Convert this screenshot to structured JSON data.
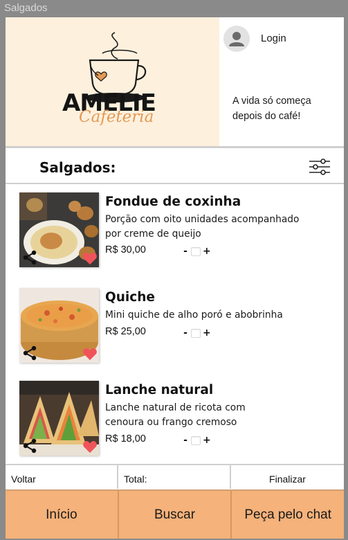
{
  "window": {
    "title": "Salgados"
  },
  "header": {
    "logo_title": "AMELIE",
    "logo_subtitle": "Cafeteria",
    "login_label": "Login",
    "tagline": "A vida só começa depois do café!"
  },
  "section": {
    "title": "Salgados:"
  },
  "items": [
    {
      "name": "Fondue de coxinha",
      "description": "Porção com oito unidades acompanhado por creme de queijo",
      "price": "R$ 30,00",
      "minus": "-",
      "plus": "+"
    },
    {
      "name": "Quiche",
      "description": "Mini quiche de alho poró e abobrinha",
      "price": "R$ 25,00",
      "minus": "-",
      "plus": "+"
    },
    {
      "name": "Lanche natural",
      "description": "Lanche natural de ricota com cenoura ou frango cremoso",
      "price": "R$ 18,00",
      "minus": "-",
      "plus": "+"
    }
  ],
  "summary": {
    "back_label": "Voltar",
    "total_label": "Total:",
    "finish_label": "Finalizar"
  },
  "nav": {
    "home": "Início",
    "search": "Buscar",
    "chat": "Peça pelo chat"
  },
  "colors": {
    "accent": "#f5b27a",
    "hero_bg": "#fdf0dd",
    "heart": "#f0545a",
    "logo_script": "#e39a55"
  },
  "icons": {
    "filter": "sliders-icon",
    "share": "share-icon",
    "favorite": "heart-icon",
    "avatar": "user-icon"
  }
}
